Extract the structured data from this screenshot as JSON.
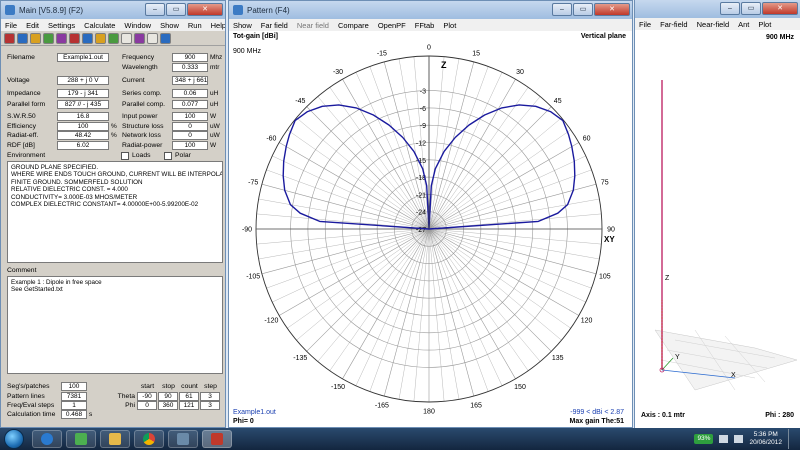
{
  "main_window": {
    "title": "Main  [V5.8.9]  (F2)",
    "menu": [
      "File",
      "Edit",
      "Settings",
      "Calculate",
      "Window",
      "Show",
      "Run",
      "Help"
    ],
    "fields_left": [
      {
        "label": "Filename",
        "value": "Example1.out",
        "unit": ""
      },
      {
        "label": "Voltage",
        "value": "288 + j 0 V",
        "unit": ""
      },
      {
        "label": "Impedance",
        "value": "179 - j 341",
        "unit": ""
      },
      {
        "label": "Parallel form",
        "value": "827 // - j 435",
        "unit": ""
      },
      {
        "label": "S.W.R.50",
        "value": "16.8",
        "unit": ""
      },
      {
        "label": "Efficiency",
        "value": "100",
        "unit": "%"
      },
      {
        "label": "Radiat-eff.",
        "value": "48.42",
        "unit": "%"
      },
      {
        "label": "RDF [dB]",
        "value": "6.02",
        "unit": ""
      }
    ],
    "fields_right": [
      {
        "label": "Frequency",
        "value": "900",
        "unit": "Mhz"
      },
      {
        "label": "Wavelength",
        "value": "0.333",
        "unit": "mtr"
      },
      {
        "label": "Current",
        "value": "348 + j 661 mA",
        "unit": ""
      },
      {
        "label": "Series comp.",
        "value": "0.06",
        "unit": "uH"
      },
      {
        "label": "Parallel comp.",
        "value": "0.077",
        "unit": "uH"
      },
      {
        "label": "Input power",
        "value": "100",
        "unit": "W"
      },
      {
        "label": "Structure loss",
        "value": "0",
        "unit": "uW"
      },
      {
        "label": "Network loss",
        "value": "0",
        "unit": "uW"
      },
      {
        "label": "Radiat-power",
        "value": "100",
        "unit": "W"
      }
    ],
    "environment_label": "Environment",
    "loads_label": "Loads",
    "polar_label": "Polar",
    "environment_lines": [
      "GROUND PLANE SPECIFIED.",
      "WHERE WIRE ENDS TOUCH GROUND, CURRENT WILL BE INTERPOLA",
      "FINITE GROUND.  SOMMERFELD SOLUTION",
      "RELATIVE DIELECTRIC CONST. =  4.000",
      "CONDUCTIVITY= 3.000E-03 MHOS/METER",
      "COMPLEX DIELECTRIC CONSTANT= 4.00000E+00-5.99200E-02"
    ],
    "comment_label": "Comment",
    "comment_lines": [
      "Example 1 :           Dipole in free space",
      "See GetStarted.txt"
    ],
    "stats": [
      {
        "label": "Seg's/patches",
        "value": "100"
      },
      {
        "label": "Pattern lines",
        "value": "7381"
      },
      {
        "label": "Freq/Eval steps",
        "value": "1"
      },
      {
        "label": "Calculation time",
        "value": "0.468",
        "unit": "s"
      }
    ],
    "sweep_headers": [
      "start",
      "stop",
      "count",
      "step"
    ],
    "sweep_rows": [
      {
        "label": "Theta",
        "values": [
          "-90",
          "90",
          "61",
          "3"
        ]
      },
      {
        "label": "Phi",
        "values": [
          "0",
          "360",
          "121",
          "3"
        ]
      }
    ]
  },
  "pattern_window": {
    "title": "Pattern    (F4)",
    "menu": [
      "Show",
      "Far field",
      "Near field",
      "Compare",
      "OpenPF",
      "FFtab",
      "Plot"
    ],
    "tot_gain_label": "Tot-gain [dBi]",
    "freq_label": "900 MHz",
    "plane_label": "Vertical plane",
    "filename": "Example1.out",
    "phi_label": "Phi= 0",
    "range_label": "-999 < dBi < 2.87",
    "max_gain_label": "Max gain The:51"
  },
  "chart_data": {
    "type": "polar",
    "title": "Tot-gain [dBi]",
    "subtitle": "Vertical plane",
    "angle_labels": [
      "0",
      "15",
      "30",
      "45",
      "60",
      "75",
      "90",
      "105",
      "120",
      "135",
      "150",
      "165",
      "180",
      "-165",
      "-150",
      "-135",
      "-120",
      "-105",
      "-90",
      "-75",
      "-60",
      "-45",
      "-30",
      "-15"
    ],
    "radial_labels": [
      "-3",
      "-6",
      "-9",
      "-12",
      "-15",
      "-18",
      "-21",
      "-24",
      "-27"
    ],
    "axis_labels": {
      "top": "Z",
      "right": "XY"
    },
    "r_range_dbi": [
      -27,
      3
    ],
    "series": [
      {
        "theta_deg": [
          -90,
          -86,
          -83,
          -80,
          -75,
          -70,
          -65,
          -60,
          -56,
          -51,
          -46,
          -41,
          -36,
          -31,
          -26,
          -21,
          -16,
          -11,
          -6,
          -3,
          0,
          3,
          6,
          11,
          16,
          21,
          26,
          31,
          36,
          41,
          46,
          51,
          56,
          60,
          65,
          70,
          75,
          80,
          83,
          86,
          90
        ],
        "gain_dbi": [
          -27,
          -8,
          -4.5,
          -2.6,
          -1.1,
          -0.1,
          0.8,
          1.6,
          2.2,
          2.87,
          2.3,
          1.2,
          -0.4,
          -2.5,
          -5.0,
          -7.7,
          -10.5,
          -13.3,
          -16.5,
          -19.5,
          -27,
          -19.5,
          -16.5,
          -13.3,
          -10.5,
          -7.7,
          -5.0,
          -2.5,
          -0.4,
          1.2,
          2.3,
          2.87,
          2.2,
          1.6,
          0.8,
          -0.1,
          -1.1,
          -2.6,
          -4.5,
          -8,
          -27
        ]
      }
    ]
  },
  "geo_window": {
    "menu": [
      "File",
      "Far-field",
      "Near-field",
      "Ant",
      "Plot"
    ],
    "freq_label": "900 MHz",
    "axis_z": "Z",
    "axis_y": "Y",
    "axis_x": "X",
    "axis_info": "Axis : 0.1 mtr",
    "phi_info": "Phi : 280"
  },
  "taskbar": {
    "battery": "93%",
    "time": "5:36 PM",
    "date": "20/06/2012"
  },
  "colors": {
    "pattern_line": "#1a1a9e",
    "grid": "#9a9a9a"
  }
}
